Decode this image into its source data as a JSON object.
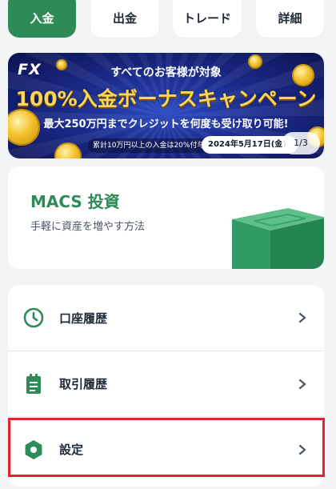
{
  "actions": [
    {
      "label": "入金",
      "primary": true
    },
    {
      "label": "出金",
      "primary": false
    },
    {
      "label": "トレード",
      "primary": false
    },
    {
      "label": "詳細",
      "primary": false
    }
  ],
  "banner": {
    "badge": "FX",
    "line1": "すべてのお客様が対象",
    "line2": "100%入金ボーナスキャンペーン",
    "line3": "最大250万円までクレジットを何度も受け取り可能!",
    "note": "累計10万円以上の入金は20%付与",
    "date": "2024年5月17日(金)",
    "pager": "1/3"
  },
  "macs": {
    "title": "MACS 投資",
    "subtitle": "手軽に資産を増やす方法"
  },
  "menu": {
    "items": [
      {
        "label": "口座履歴",
        "icon": "clock-icon"
      },
      {
        "label": "取引履歴",
        "icon": "document-icon"
      },
      {
        "label": "設定",
        "icon": "gear-hexagon-icon"
      }
    ]
  },
  "colors": {
    "accent": "#2e8b57",
    "highlight": "#e3232b",
    "background": "#f3f4f6"
  }
}
